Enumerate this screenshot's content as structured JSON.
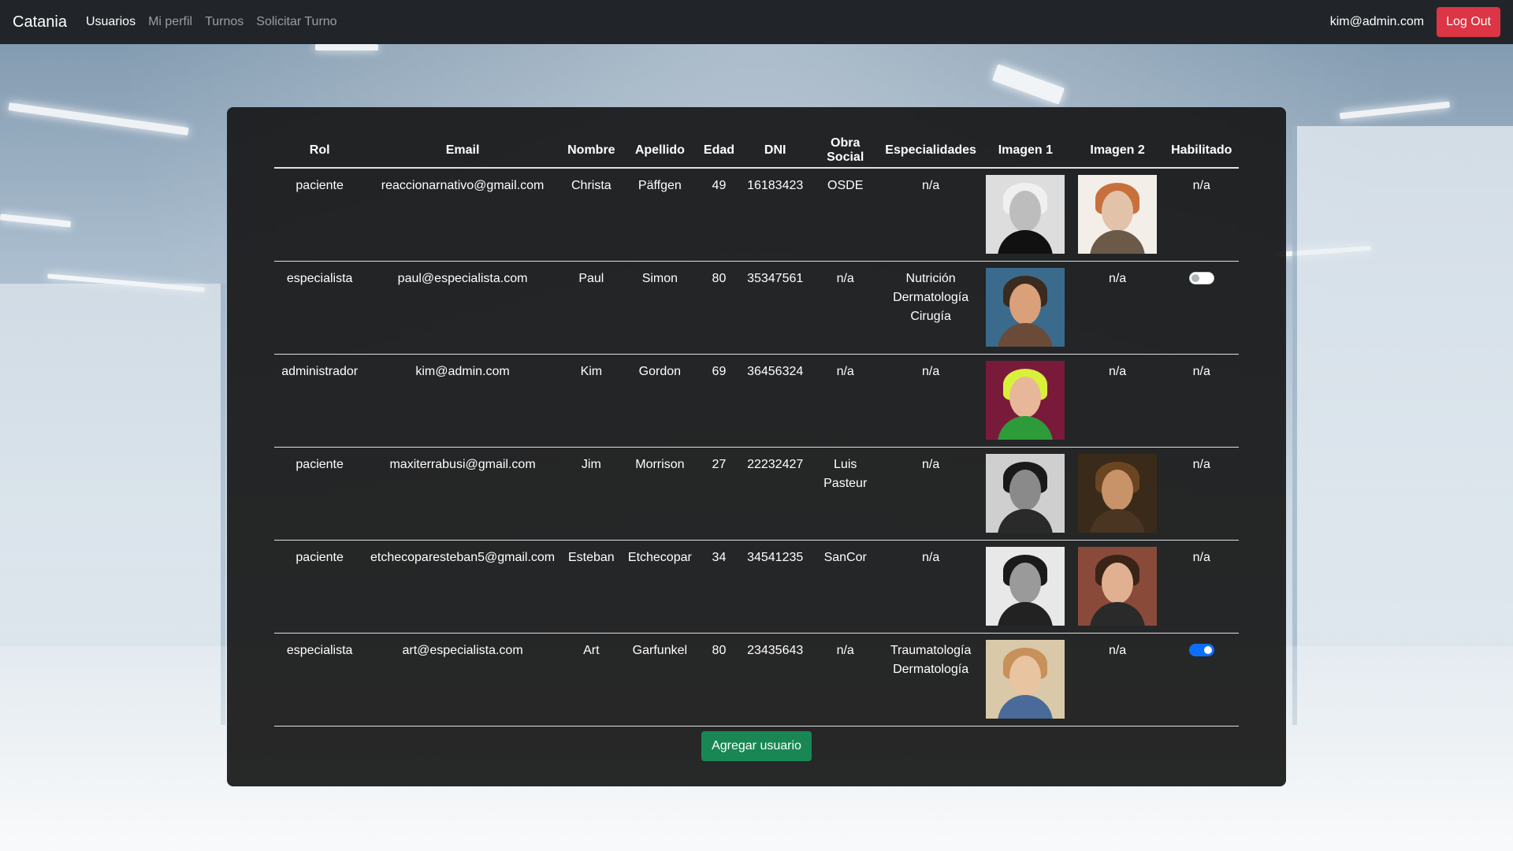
{
  "app": {
    "brand": "Catania",
    "nav": [
      "Usuarios",
      "Mi perfil",
      "Turnos",
      "Solicitar Turno"
    ],
    "user_email": "kim@admin.com",
    "logout_label": "Log Out"
  },
  "table": {
    "headers": [
      "Rol",
      "Email",
      "Nombre",
      "Apellido",
      "Edad",
      "DNI",
      "Obra Social",
      "Especialidades",
      "Imagen 1",
      "Imagen 2",
      "Habilitado"
    ],
    "rows": [
      {
        "rol": "paciente",
        "email": "reaccionarnativo@gmail.com",
        "nombre": "Christa",
        "apellido": "Päffgen",
        "edad": "49",
        "dni": "16183423",
        "obra": "OSDE",
        "esp1": "n/a",
        "esp2": "",
        "esp3": "",
        "img2": "",
        "hab": "n/a"
      },
      {
        "rol": "especialista",
        "email": "paul@especialista.com",
        "nombre": "Paul",
        "apellido": "Simon",
        "edad": "80",
        "dni": "35347561",
        "obra": "n/a",
        "esp1": "Nutrición",
        "esp2": "Dermatología",
        "esp3": "Cirugía",
        "img2": "n/a",
        "hab": ""
      },
      {
        "rol": "administrador",
        "email": "kim@admin.com",
        "nombre": "Kim",
        "apellido": "Gordon",
        "edad": "69",
        "dni": "36456324",
        "obra": "n/a",
        "esp1": "n/a",
        "esp2": "",
        "esp3": "",
        "img2": "n/a",
        "hab": "n/a"
      },
      {
        "rol": "paciente",
        "email": "maxiterrabusi@gmail.com",
        "nombre": "Jim",
        "apellido": "Morrison",
        "edad": "27",
        "dni": "22232427",
        "obra": "Luis Pasteur",
        "esp1": "n/a",
        "esp2": "",
        "esp3": "",
        "img2": "",
        "hab": "n/a"
      },
      {
        "rol": "paciente",
        "email": "etchecoparesteban5@gmail.com",
        "nombre": "Esteban",
        "apellido": "Etchecopar",
        "edad": "34",
        "dni": "34541235",
        "obra": "SanCor",
        "esp1": "n/a",
        "esp2": "",
        "esp3": "",
        "img2": "",
        "hab": "n/a"
      },
      {
        "rol": "especialista",
        "email": "art@especialista.com",
        "nombre": "Art",
        "apellido": "Garfunkel",
        "edad": "80",
        "dni": "23435643",
        "obra": "n/a",
        "esp1": "Traumatología",
        "esp2": "Dermatología",
        "esp3": "",
        "img2": "n/a",
        "hab": ""
      }
    ]
  },
  "toggles": {
    "paul": false,
    "art": true
  },
  "add_button_label": "Agregar usuario",
  "colors": {
    "navbar": "#212529",
    "logout": "#dc3545",
    "add": "#198754",
    "toggle_on": "#0d6efd"
  }
}
